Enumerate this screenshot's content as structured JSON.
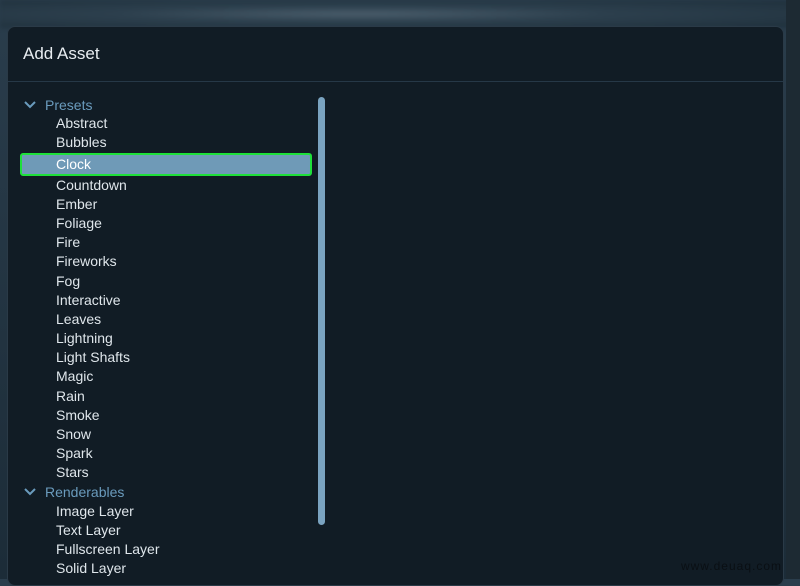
{
  "dialog": {
    "title": "Add Asset"
  },
  "tree": {
    "groups": [
      {
        "label": "Presets",
        "expanded": true,
        "items": [
          "Abstract",
          "Bubbles",
          "Clock",
          "Countdown",
          "Ember",
          "Foliage",
          "Fire",
          "Fireworks",
          "Fog",
          "Interactive",
          "Leaves",
          "Lightning",
          "Light Shafts",
          "Magic",
          "Rain",
          "Smoke",
          "Snow",
          "Spark",
          "Stars"
        ]
      },
      {
        "label": "Renderables",
        "expanded": true,
        "items": [
          "Image Layer",
          "Text Layer",
          "Fullscreen Layer",
          "Solid Layer"
        ]
      }
    ],
    "selected": "Clock"
  },
  "watermark": "www.deuaq.com",
  "colors": {
    "selection_fill": "#6f9ab7",
    "selection_outline": "#1ee03a",
    "group_label": "#6a9bbd"
  }
}
